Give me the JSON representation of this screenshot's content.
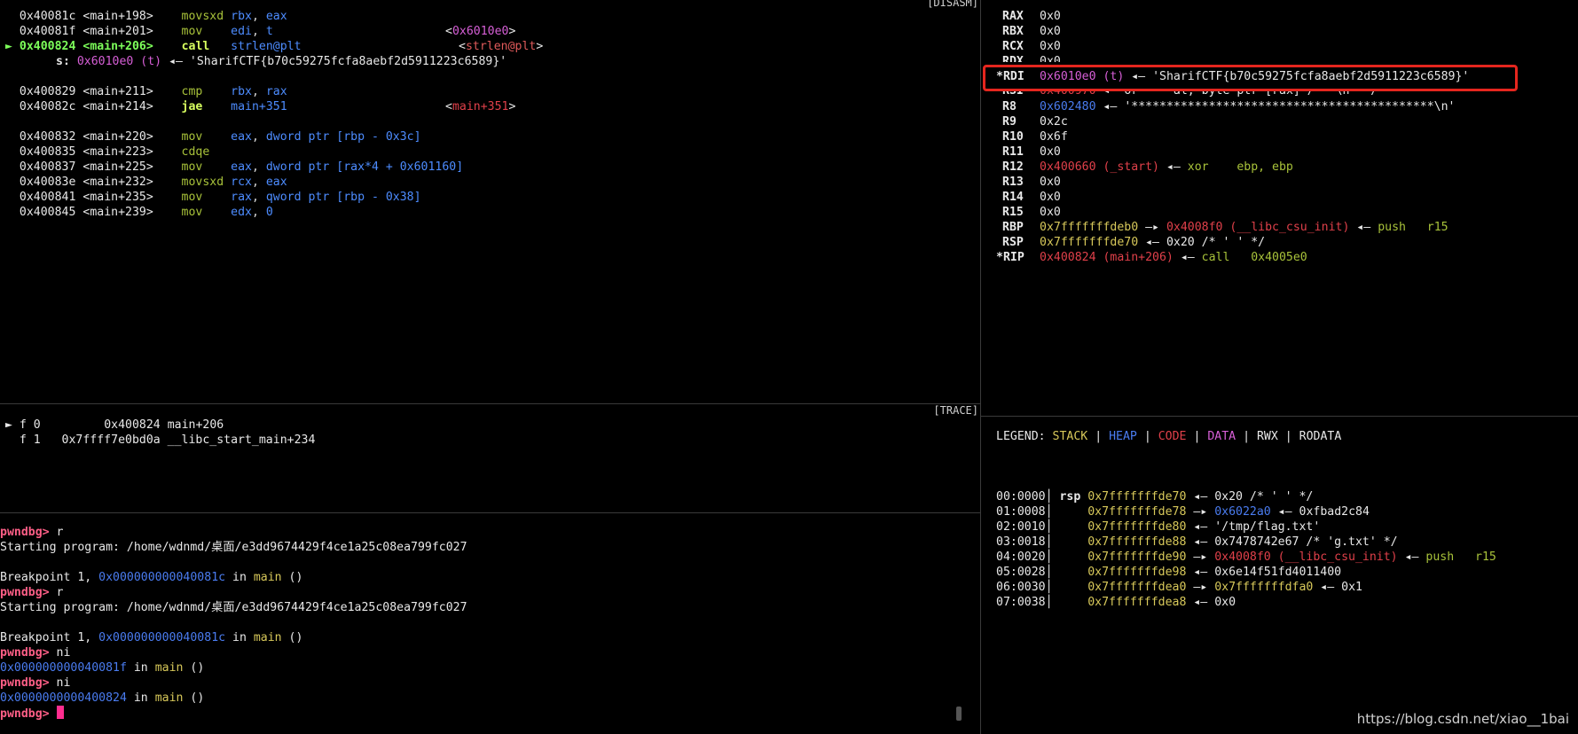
{
  "disasm": {
    "tag": "[DISASM]",
    "lines": [
      {
        "arrow": "",
        "addr": "0x40081c",
        "sym": "<main+198>",
        "mn": "movsxd",
        "op1": "rbx",
        "op2": "eax",
        "ref": ""
      },
      {
        "arrow": "",
        "addr": "0x40081f",
        "sym": "<main+201>",
        "mn": "mov",
        "op1": "edi",
        "op2": "t",
        "ref": "0x6010e0"
      },
      {
        "arrow": "►",
        "addr": "0x400824",
        "sym": "<main+206>",
        "mn": "call",
        "op1": "strlen@plt",
        "op2": "",
        "ref": "strlen@plt"
      },
      {
        "sub_key": "s:",
        "sub_addr": "0x6010e0 (t)",
        "sub_val": "'SharifCTF{b70c59275fcfa8aebf2d5911223c6589}'"
      },
      {
        "arrow": "",
        "addr": "0x400829",
        "sym": "<main+211>",
        "mn": "cmp",
        "op1": "rbx",
        "op2": "rax",
        "ref": ""
      },
      {
        "arrow": "",
        "addr": "0x40082c",
        "sym": "<main+214>",
        "mn": "jae",
        "op1": "main+351",
        "op2": "",
        "ref": "main+351"
      },
      {
        "arrow": "",
        "addr": "0x400832",
        "sym": "<main+220>",
        "mn": "mov",
        "op1": "eax",
        "op2": "dword ptr [rbp - 0x3c]",
        "ref": ""
      },
      {
        "arrow": "",
        "addr": "0x400835",
        "sym": "<main+223>",
        "mn": "cdqe",
        "op1": "",
        "op2": "",
        "ref": ""
      },
      {
        "arrow": "",
        "addr": "0x400837",
        "sym": "<main+225>",
        "mn": "mov",
        "op1": "eax",
        "op2": "dword ptr [rax*4 + 0x601160]",
        "ref": ""
      },
      {
        "arrow": "",
        "addr": "0x40083e",
        "sym": "<main+232>",
        "mn": "movsxd",
        "op1": "rcx",
        "op2": "eax",
        "ref": ""
      },
      {
        "arrow": "",
        "addr": "0x400841",
        "sym": "<main+235>",
        "mn": "mov",
        "op1": "rax",
        "op2": "qword ptr [rbp - 0x38]",
        "ref": ""
      },
      {
        "arrow": "",
        "addr": "0x400845",
        "sym": "<main+239>",
        "mn": "mov",
        "op1": "edx",
        "op2": "0",
        "ref": ""
      }
    ]
  },
  "trace": {
    "tag": "[TRACE]",
    "frames": [
      {
        "arrow": "►",
        "label": "f 0",
        "addr": "0x400824",
        "fn": "main+206"
      },
      {
        "arrow": "",
        "label": "f 1",
        "addr": "0x7ffff7e0bd0a",
        "fn": "__libc_start_main+234"
      }
    ]
  },
  "console": {
    "prompt": "pwndbg>",
    "lines": [
      {
        "kind": "cmd",
        "text": "r"
      },
      {
        "kind": "out",
        "text": "Starting program: /home/wdnmd/桌面/e3dd9674429f4ce1a25c08ea799fc027"
      },
      {
        "kind": "blank",
        "text": ""
      },
      {
        "kind": "bp",
        "pre": "Breakpoint 1, ",
        "addr": "0x000000000040081c",
        "mid": " in ",
        "fn": "main",
        "post": " ()"
      },
      {
        "kind": "cmd",
        "text": "r"
      },
      {
        "kind": "out",
        "text": "Starting program: /home/wdnmd/桌面/e3dd9674429f4ce1a25c08ea799fc027"
      },
      {
        "kind": "blank",
        "text": ""
      },
      {
        "kind": "bp",
        "pre": "Breakpoint 1, ",
        "addr": "0x000000000040081c",
        "mid": " in ",
        "fn": "main",
        "post": " ()"
      },
      {
        "kind": "cmd",
        "text": "ni"
      },
      {
        "kind": "bp",
        "pre": "",
        "addr": "0x000000000040081f",
        "mid": " in ",
        "fn": "main",
        "post": " ()"
      },
      {
        "kind": "cmd",
        "text": "ni"
      },
      {
        "kind": "bp",
        "pre": "",
        "addr": "0x0000000000400824",
        "mid": " in ",
        "fn": "main",
        "post": " ()"
      },
      {
        "kind": "input",
        "text": ""
      }
    ]
  },
  "registers": {
    "rows": [
      {
        "name": "RAX",
        "val": "0x0"
      },
      {
        "name": "RBX",
        "val": "0x0"
      },
      {
        "name": "RCX",
        "val": "0x0"
      },
      {
        "name": "RDX",
        "val": "0x0"
      },
      {
        "name": "*RDI",
        "val": "0x6010e0 (t)",
        "arrow": "◂—",
        "rest": "'SharifCTF{b70c59275fcfa8aebf2d5911223c6589}'"
      },
      {
        "name": "RSI",
        "val": "0x400970",
        "arrow": "◂—",
        "rest": "or     al, byte ptr [rax] /* '\\n' */"
      },
      {
        "name": "R8",
        "val": "0x602480",
        "arrow": "◂—",
        "rest": "'*******************************************\\n'"
      },
      {
        "name": "R9",
        "val": "0x2c"
      },
      {
        "name": "R10",
        "val": "0x6f"
      },
      {
        "name": "R11",
        "val": "0x0"
      },
      {
        "name": "R12",
        "val": "0x400660 (_start)",
        "arrow": "◂—",
        "rest": "xor    ebp, ebp"
      },
      {
        "name": "R13",
        "val": "0x0"
      },
      {
        "name": "R14",
        "val": "0x0"
      },
      {
        "name": "R15",
        "val": "0x0"
      },
      {
        "name": "RBP",
        "val": "0x7fffffffdeb0",
        "arrow": "—▸",
        "rest": "0x4008f0 (__libc_csu_init)",
        "arrow2": "◂—",
        "rest2": "push   r15"
      },
      {
        "name": "RSP",
        "val": "0x7fffffffde70",
        "arrow": "◂—",
        "rest": "0x20 /* ' ' */"
      },
      {
        "name": "*RIP",
        "val": "0x400824 (main+206)",
        "arrow": "◂—",
        "rest": "call   0x4005e0"
      }
    ]
  },
  "legend": {
    "label": "LEGEND:",
    "items": [
      "STACK",
      "HEAP",
      "CODE",
      "DATA",
      "RWX",
      "RODATA"
    ],
    "sep": "|"
  },
  "stack": {
    "rows": [
      {
        "off": "00:0000",
        "reg": "rsp",
        "addr": "0x7fffffffde70",
        "arrow": "◂—",
        "val": "0x20 /* ' ' */"
      },
      {
        "off": "01:0008",
        "reg": "",
        "addr": "0x7fffffffde78",
        "arrow": "—▸",
        "val": "0x6022a0",
        "arrow2": "◂—",
        "val2": "0xfbad2c84"
      },
      {
        "off": "02:0010",
        "reg": "",
        "addr": "0x7fffffffde80",
        "arrow": "◂—",
        "val": "'/tmp/flag.txt'"
      },
      {
        "off": "03:0018",
        "reg": "",
        "addr": "0x7fffffffde88",
        "arrow": "◂—",
        "val": "0x7478742e67 /* 'g.txt' */"
      },
      {
        "off": "04:0020",
        "reg": "",
        "addr": "0x7fffffffde90",
        "arrow": "—▸",
        "val": "0x4008f0 (__libc_csu_init)",
        "arrow2": "◂—",
        "val2": "push   r15"
      },
      {
        "off": "05:0028",
        "reg": "",
        "addr": "0x7fffffffde98",
        "arrow": "◂—",
        "val": "0x6e14f51fd4011400"
      },
      {
        "off": "06:0030",
        "reg": "",
        "addr": "0x7fffffffdea0",
        "arrow": "—▸",
        "val": "0x7fffffffdfa0",
        "arrow2": "◂—",
        "val2": "0x1"
      },
      {
        "off": "07:0038",
        "reg": "",
        "addr": "0x7fffffffdea8",
        "arrow": "◂—",
        "val": "0x0"
      }
    ]
  },
  "watermark": "https://blog.csdn.net/xiao__1bai",
  "colors": {
    "highlight_box": "#e5261e",
    "prompt": "#ff5f87",
    "cursor": "#ff2d8f"
  }
}
